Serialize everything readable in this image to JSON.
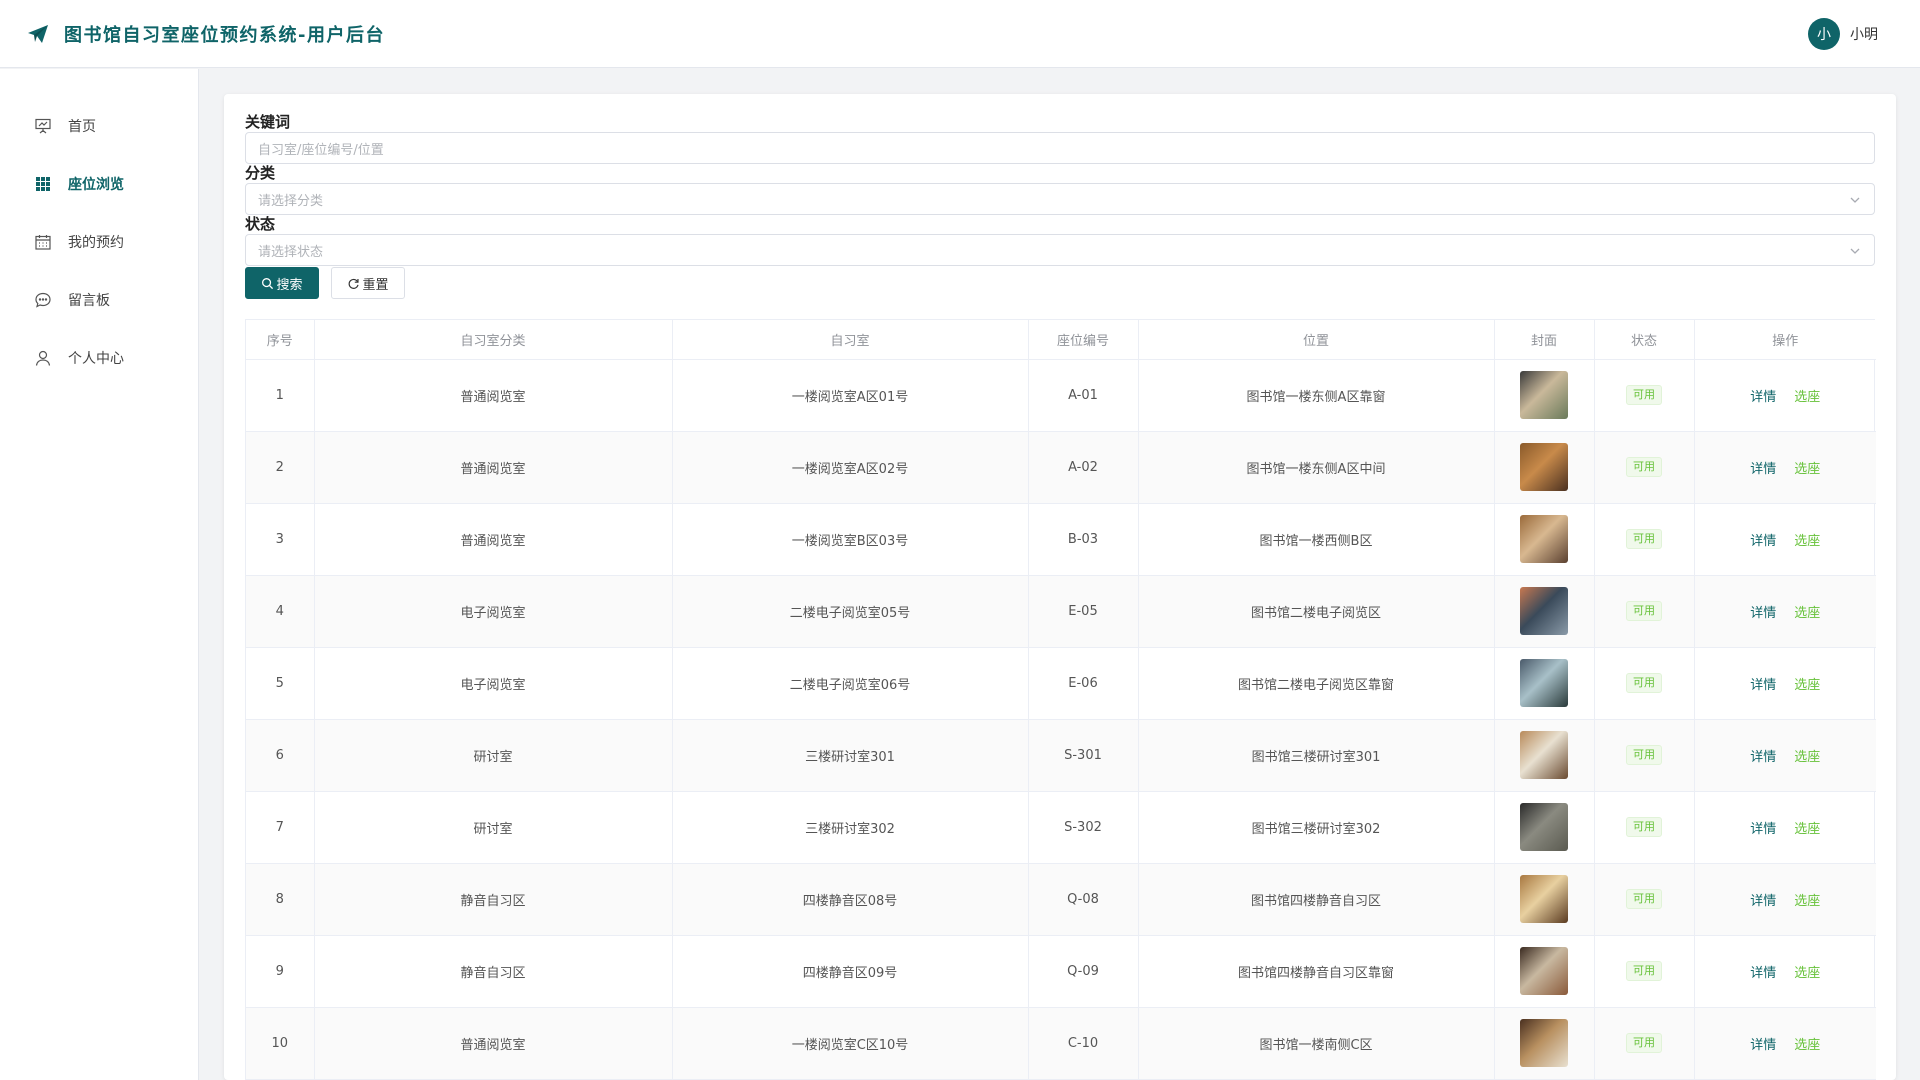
{
  "app": {
    "title": "图书馆自习室座位预约系统-用户后台",
    "user_name": "小明",
    "avatar_text": "小",
    "brand_color": "#0f6468"
  },
  "sidebar": {
    "items": [
      {
        "label": "首页",
        "icon": "presentation-icon",
        "active": false
      },
      {
        "label": "座位浏览",
        "icon": "grid-icon",
        "active": true
      },
      {
        "label": "我的预约",
        "icon": "calendar-icon",
        "active": false
      },
      {
        "label": "留言板",
        "icon": "chat-icon",
        "active": false
      },
      {
        "label": "个人中心",
        "icon": "user-icon",
        "active": false
      }
    ]
  },
  "filters": {
    "keyword_label": "关键词",
    "keyword_placeholder": "自习室/座位编号/位置",
    "category_label": "分类",
    "category_placeholder": "请选择分类",
    "status_label": "状态",
    "status_placeholder": "请选择状态",
    "search_button": "搜索",
    "reset_button": "重置"
  },
  "table": {
    "headers": [
      "序号",
      "自习室分类",
      "自习室",
      "座位编号",
      "位置",
      "封面",
      "状态",
      "操作"
    ],
    "detail_label": "详情",
    "select_label": "选座",
    "rows": [
      {
        "index": "1",
        "category": "普通阅览室",
        "room": "一楼阅览室A区01号",
        "seat": "A-01",
        "location": "图书馆一楼东侧A区靠窗",
        "status": "可用",
        "cover_colors": [
          "#3a3a3a",
          "#c9b89a",
          "#6a7a5a"
        ]
      },
      {
        "index": "2",
        "category": "普通阅览室",
        "room": "一楼阅览室A区02号",
        "seat": "A-02",
        "location": "图书馆一楼东侧A区中间",
        "status": "可用",
        "cover_colors": [
          "#8a5a2a",
          "#c88a4a",
          "#4a3020"
        ]
      },
      {
        "index": "3",
        "category": "普通阅览室",
        "room": "一楼阅览室B区03号",
        "seat": "B-03",
        "location": "图书馆一楼西侧B区",
        "status": "可用",
        "cover_colors": [
          "#9a6a3a",
          "#d8b890",
          "#5a4030"
        ]
      },
      {
        "index": "4",
        "category": "电子阅览室",
        "room": "二楼电子阅览室05号",
        "seat": "E-05",
        "location": "图书馆二楼电子阅览区",
        "status": "可用",
        "cover_colors": [
          "#c87850",
          "#3a4a5a",
          "#8a9aa8"
        ]
      },
      {
        "index": "5",
        "category": "电子阅览室",
        "room": "二楼电子阅览室06号",
        "seat": "E-06",
        "location": "图书馆二楼电子阅览区靠窗",
        "status": "可用",
        "cover_colors": [
          "#4a5a6a",
          "#a8c0c8",
          "#2a3a3a"
        ]
      },
      {
        "index": "6",
        "category": "研讨室",
        "room": "三楼研讨室301",
        "seat": "S-301",
        "location": "图书馆三楼研讨室301",
        "status": "可用",
        "cover_colors": [
          "#b88a5a",
          "#e8e0d0",
          "#6a4a30"
        ]
      },
      {
        "index": "7",
        "category": "研讨室",
        "room": "三楼研讨室302",
        "seat": "S-302",
        "location": "图书馆三楼研讨室302",
        "status": "可用",
        "cover_colors": [
          "#2a2a2a",
          "#8a8a80",
          "#5a5a50"
        ]
      },
      {
        "index": "8",
        "category": "静音自习区",
        "room": "四楼静音区08号",
        "seat": "Q-08",
        "location": "图书馆四楼静音自习区",
        "status": "可用",
        "cover_colors": [
          "#a87840",
          "#e8d0a0",
          "#5a3a20"
        ]
      },
      {
        "index": "9",
        "category": "静音自习区",
        "room": "四楼静音区09号",
        "seat": "Q-09",
        "location": "图书馆四楼静音自习区靠窗",
        "status": "可用",
        "cover_colors": [
          "#3a2a20",
          "#c8b8a0",
          "#8a5a3a"
        ]
      },
      {
        "index": "10",
        "category": "普通阅览室",
        "room": "一楼阅览室C区10号",
        "seat": "C-10",
        "location": "图书馆一楼南侧C区",
        "status": "可用",
        "cover_colors": [
          "#4a3020",
          "#b89060",
          "#e8e0d0"
        ]
      }
    ]
  }
}
